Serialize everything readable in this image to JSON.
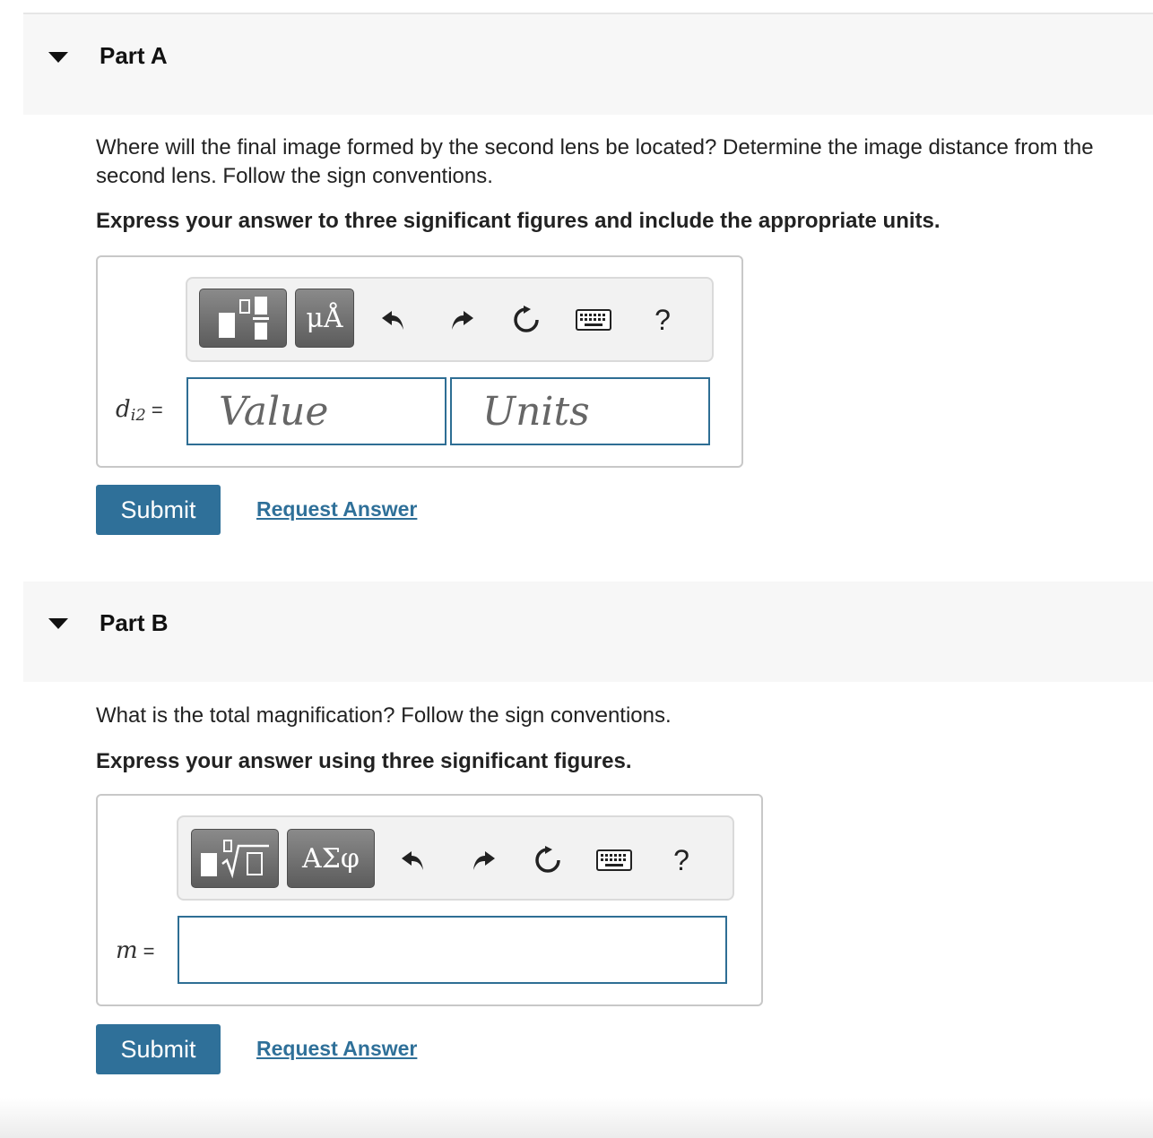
{
  "partA": {
    "title": "Part A",
    "question": "Where will the final image formed by the second lens be located? Determine the image distance from the second lens. Follow the sign conventions.",
    "instruction": "Express your answer to three significant figures and include the appropriate units.",
    "toolbar": {
      "units_btn": "μÅ",
      "help": "?"
    },
    "variable": {
      "symbol": "d",
      "subscript": "i2",
      "equals": "="
    },
    "value_placeholder": "Value",
    "units_placeholder": "Units",
    "submit_label": "Submit",
    "request_label": "Request Answer"
  },
  "partB": {
    "title": "Part B",
    "question": "What is the total magnification? Follow the sign conventions.",
    "instruction": "Express your answer using three significant figures.",
    "toolbar": {
      "greek_btn": "ΑΣφ",
      "help": "?"
    },
    "variable": {
      "symbol": "m",
      "equals": "="
    },
    "submit_label": "Submit",
    "request_label": "Request Answer"
  },
  "colors": {
    "accent": "#2f7099",
    "header_bg": "#f7f7f7",
    "field_border": "#2e6e94"
  }
}
